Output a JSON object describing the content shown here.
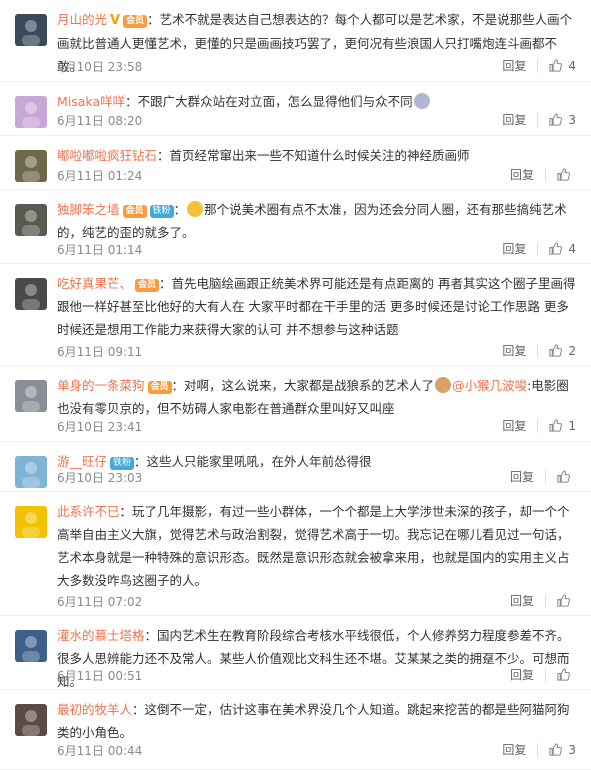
{
  "comments": [
    {
      "user": "月山的光",
      "badges": [
        "V",
        "会员"
      ],
      "segments": [
        {
          "t": "text",
          "v": "艺术不就是表达自己想表达的？每个人都可以是艺术家，不是说那些人画个画就比普通人更懂艺术，更懂的只是画画技巧罢了，更何况有些浪国人只打嘴炮连斗画都不敢。"
        }
      ],
      "time": "6月10日 23:58",
      "reply": "回复",
      "likes": "4",
      "avatar_color": "#3b4a5a"
    },
    {
      "user": "Misaka咩咩",
      "badges": [],
      "segments": [
        {
          "t": "text",
          "v": "不跟广大群众站在对立面，怎么显得他们与众不同"
        },
        {
          "t": "emoji",
          "v": "shocked-emoji"
        }
      ],
      "time": "6月11日 08:20",
      "reply": "回复",
      "likes": "3",
      "avatar_color": "#c9a6d8"
    },
    {
      "user": "嘟啦嘟啦疯狂钻石",
      "badges": [],
      "segments": [
        {
          "t": "text",
          "v": "首页经常窜出来一些不知道什么时候关注的神经质画师"
        }
      ],
      "time": "6月11日 01:24",
      "reply": "回复",
      "likes": "",
      "avatar_color": "#6d6a4a"
    },
    {
      "user": "独脚笨之墙",
      "badges": [
        "会员",
        "铁粉"
      ],
      "segments": [
        {
          "t": "emoji",
          "v": "sweat-emoji"
        },
        {
          "t": "text",
          "v": "那个说美术圈有点不太准，因为还会分同人圈，还有那些搞纯艺术的，纯艺的歪的就多了。"
        }
      ],
      "time": "6月11日 01:14",
      "reply": "回复",
      "likes": "4",
      "avatar_color": "#5a5a50"
    },
    {
      "user": "吃好真果芒、",
      "badges": [
        "会员"
      ],
      "segments": [
        {
          "t": "text",
          "v": "首先电脑绘画跟正统美术界可能还是有点距离的 再者其实这个圈子里画得跟他一样好甚至比他好的大有人在 大家平时都在干手里的活 更多时候还是讨论工作思路 更多时候还是想用工作能力来获得大家的认可 并不想参与这种话题"
        }
      ],
      "time": "6月11日 09:11",
      "reply": "回复",
      "likes": "2",
      "avatar_color": "#4a4a4a"
    },
    {
      "user": "单身的一条菜狗",
      "badges": [
        "会员"
      ],
      "segments": [
        {
          "t": "text",
          "v": "对啊，这么说来，大家都是战狼系的艺术人了"
        },
        {
          "t": "emoji",
          "v": "dog-emoji"
        },
        {
          "t": "mention",
          "v": "@小猴几波唆"
        },
        {
          "t": "text",
          "v": ":电影圈也没有零贝京的，但不妨碍人家电影在普通群众里叫好又叫座"
        }
      ],
      "time": "6月10日 23:41",
      "reply": "回复",
      "likes": "1",
      "avatar_color": "#8a8e96"
    },
    {
      "user": "游__旺仔",
      "badges": [
        "铁粉"
      ],
      "segments": [
        {
          "t": "text",
          "v": "这些人只能家里吼吼，在外人年前怂得很"
        }
      ],
      "time": "6月10日 23:03",
      "reply": "回复",
      "likes": "",
      "avatar_color": "#7fb3d6"
    },
    {
      "user": "此系许不已",
      "badges": [],
      "segments": [
        {
          "t": "text",
          "v": "玩了几年摄影，有过一些小群体，一个个都是上大学涉世未深的孩子，却一个个高举自由主义大旗，觉得艺术与政治割裂，觉得艺术高于一切。我忘记在哪儿看见过一句话，艺术本身就是一种特殊的意识形态。既然是意识形态就会被拿来用，也就是国内的实用主义占大多数没咋鸟这圈子的人。"
        }
      ],
      "time": "6月11日 07:02",
      "reply": "回复",
      "likes": "",
      "avatar_color": "#f2c200"
    },
    {
      "user": "灌水的慕士塔格",
      "badges": [],
      "segments": [
        {
          "t": "text",
          "v": "国内艺术生在教育阶段综合考核水平线很低，个人修养努力程度参差不齐。很多人思辨能力还不及常人。某些人价值观比文科生还不堪。艾某某之类的拥趸不少。可想而知。"
        }
      ],
      "time": "6月11日 00:51",
      "reply": "回复",
      "likes": "",
      "avatar_color": "#3d5f8a"
    },
    {
      "user": "最初的牧羊人",
      "badges": [],
      "segments": [
        {
          "t": "text",
          "v": "这倒不一定，估计这事在美术界没几个人知道。跳起来挖苦的都是些阿猫阿狗类的小角色。"
        }
      ],
      "time": "6月11日 00:44",
      "reply": "回复",
      "likes": "3",
      "avatar_color": "#5c4a44"
    }
  ],
  "colors": {
    "username": "#eb7350",
    "time": "#8a8a8a",
    "badge_vip": "#ff9a3a",
    "badge_fan": "#44a9d8"
  }
}
